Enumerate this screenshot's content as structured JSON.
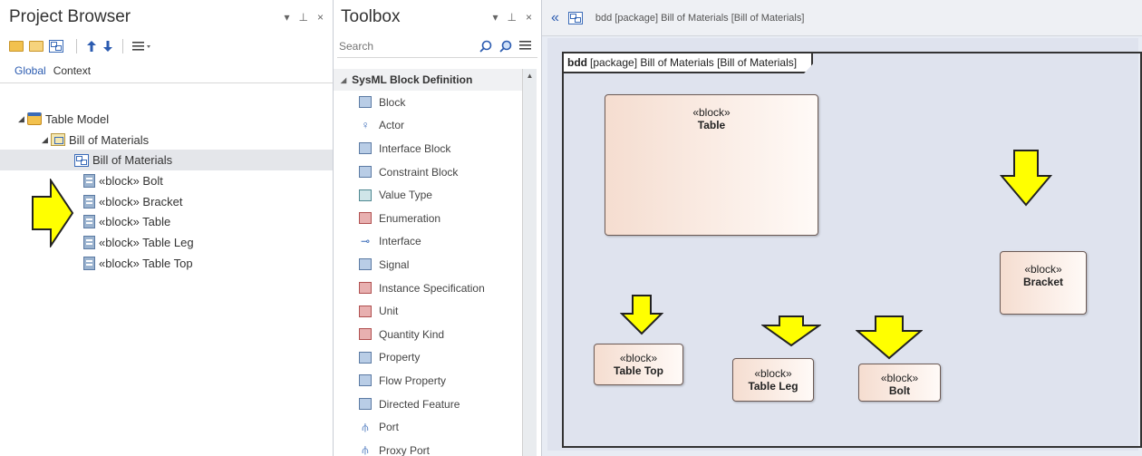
{
  "project_browser": {
    "title": "Project Browser",
    "controls": [
      "▾",
      "⊥",
      "×"
    ],
    "tabs": [
      "Global",
      "Context"
    ],
    "tree": {
      "model": "Table Model",
      "package": "Bill of Materials",
      "diagram": "Bill of Materials",
      "blocks": [
        "«block» Bolt",
        "«block» Bracket",
        "«block» Table",
        "«block» Table Leg",
        "«block» Table Top"
      ]
    }
  },
  "toolbox": {
    "title": "Toolbox",
    "controls": [
      "▾",
      "⊥",
      "×"
    ],
    "search_placeholder": "Search",
    "group": "SysML Block Definition",
    "items": [
      "Block",
      "Actor",
      "Interface Block",
      "Constraint Block",
      "Value Type",
      "Enumeration",
      "Interface",
      "Signal",
      "Instance Specification",
      "Unit",
      "Quantity Kind",
      "Property",
      "Flow Property",
      "Directed Feature",
      "Port",
      "Proxy Port"
    ]
  },
  "diagram": {
    "header": "bdd [package] Bill of Materials [Bill of Materials]",
    "frame_kind": "bdd",
    "frame_label": "[package] Bill of Materials [Bill of Materials]",
    "blocks": [
      {
        "stereotype": "«block»",
        "name": "Table"
      },
      {
        "stereotype": "«block»",
        "name": "Bracket"
      },
      {
        "stereotype": "«block»",
        "name": "Table Top"
      },
      {
        "stereotype": "«block»",
        "name": "Table Leg"
      },
      {
        "stereotype": "«block»",
        "name": "Bolt"
      }
    ]
  },
  "colors": {
    "arrow_fill": "#ffff00",
    "accent_blue": "#2b5bb0",
    "canvas_bg": "#dfe3ee"
  }
}
